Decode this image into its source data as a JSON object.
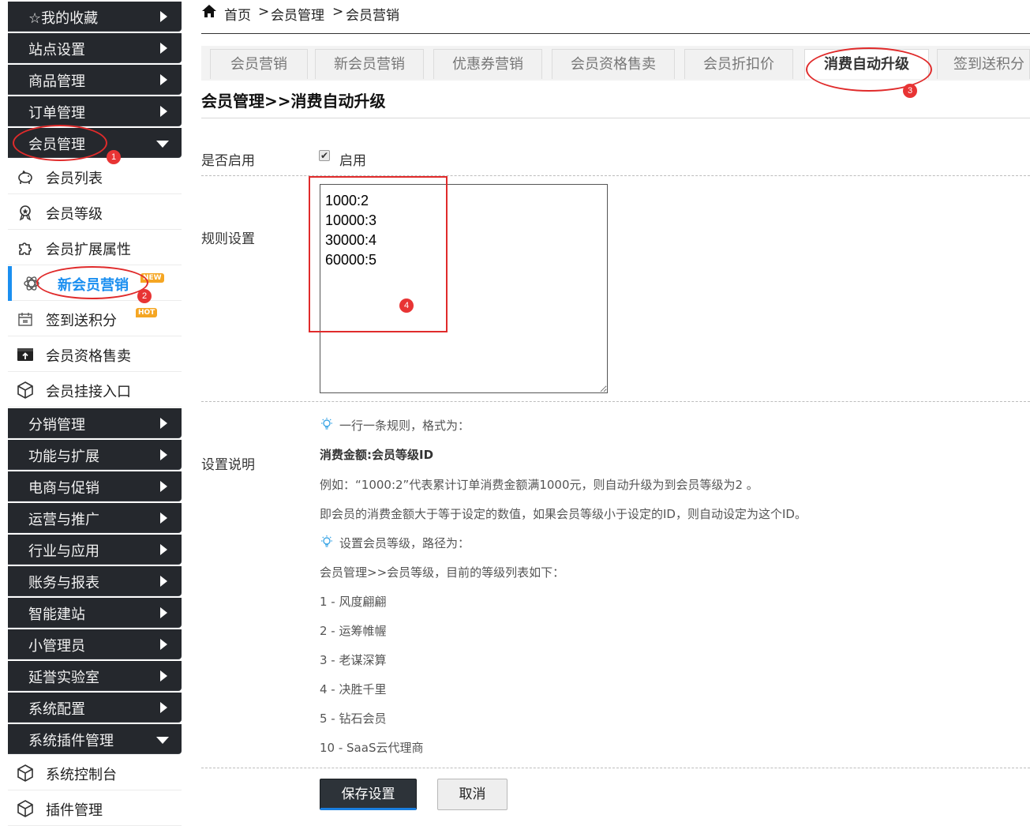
{
  "sidebar": {
    "top_groups": [
      {
        "label": "☆我的收藏"
      },
      {
        "label": "站点设置"
      },
      {
        "label": "商品管理"
      },
      {
        "label": "订单管理"
      },
      {
        "label": "会员管理"
      }
    ],
    "member_items": [
      {
        "label": "会员列表",
        "icon": "piggy-icon"
      },
      {
        "label": "会员等级",
        "icon": "medal-icon"
      },
      {
        "label": "会员扩展属性",
        "icon": "puzzle-icon"
      },
      {
        "label": "新会员营销",
        "icon": "atom-icon",
        "badge": "NEW"
      },
      {
        "label": "签到送积分",
        "icon": "calendar-icon",
        "badge": "HOT"
      },
      {
        "label": "会员资格售卖",
        "icon": "upload-box-icon"
      },
      {
        "label": "会员挂接入口",
        "icon": "cube-icon"
      }
    ],
    "bottom_groups": [
      {
        "label": "分销管理"
      },
      {
        "label": "功能与扩展"
      },
      {
        "label": "电商与促销"
      },
      {
        "label": "运营与推广"
      },
      {
        "label": "行业与应用"
      },
      {
        "label": "账务与报表"
      },
      {
        "label": "智能建站"
      },
      {
        "label": "小管理员"
      },
      {
        "label": "延誉实验室"
      },
      {
        "label": "系统配置"
      },
      {
        "label": "系统插件管理"
      }
    ],
    "plugin_items": [
      {
        "label": "系统控制台",
        "icon": "cube-icon"
      },
      {
        "label": "插件管理",
        "icon": "cube-icon"
      }
    ]
  },
  "annotations": [
    "1",
    "2",
    "3",
    "4"
  ],
  "breadcrumb": {
    "items": [
      "首页",
      "会员管理",
      "会员营销"
    ],
    "sep": ">"
  },
  "tabs": [
    {
      "label": "会员营销"
    },
    {
      "label": "新会员营销"
    },
    {
      "label": "优惠券营销"
    },
    {
      "label": "会员资格售卖"
    },
    {
      "label": "会员折扣价"
    },
    {
      "label": "消费自动升级",
      "active": true
    },
    {
      "label": "签到送积分"
    }
  ],
  "page_title": "会员管理>>消费自动升级",
  "form": {
    "enable_label": "是否启用",
    "enable_checkbox_text": "启用",
    "enabled": true,
    "rules_label": "规则设置",
    "rules_value": "1000:2\n10000:3\n30000:4\n60000:5",
    "desc_label": "设置说明",
    "desc": {
      "tip1": "一行一条规则，格式为：",
      "format": "消费金额:会员等级ID",
      "example": "例如：“1000:2”代表累计订单消费金额满1000元，则自动升级为到会员等级为2 。",
      "explain": "即会员的消费金额大于等于设定的数值，如果会员等级小于设定的ID，则自动设定为这个ID。",
      "tip2": "设置会员等级，路径为：",
      "path": "会员管理>>会员等级，目前的等级列表如下：",
      "levels": [
        "1 - 风度翩翩",
        "2 - 运筹帷幄",
        "3 - 老谋深算",
        "4 - 决胜千里",
        "5 - 钻石会员",
        "10 - SaaS云代理商"
      ]
    },
    "save_label": "保存设置",
    "cancel_label": "取消"
  },
  "colors": {
    "sidebar_dark": "#25282d",
    "accent": "#1b8ff0",
    "annotation_red": "#e02b2b",
    "badge_orange": "#f5a623"
  }
}
